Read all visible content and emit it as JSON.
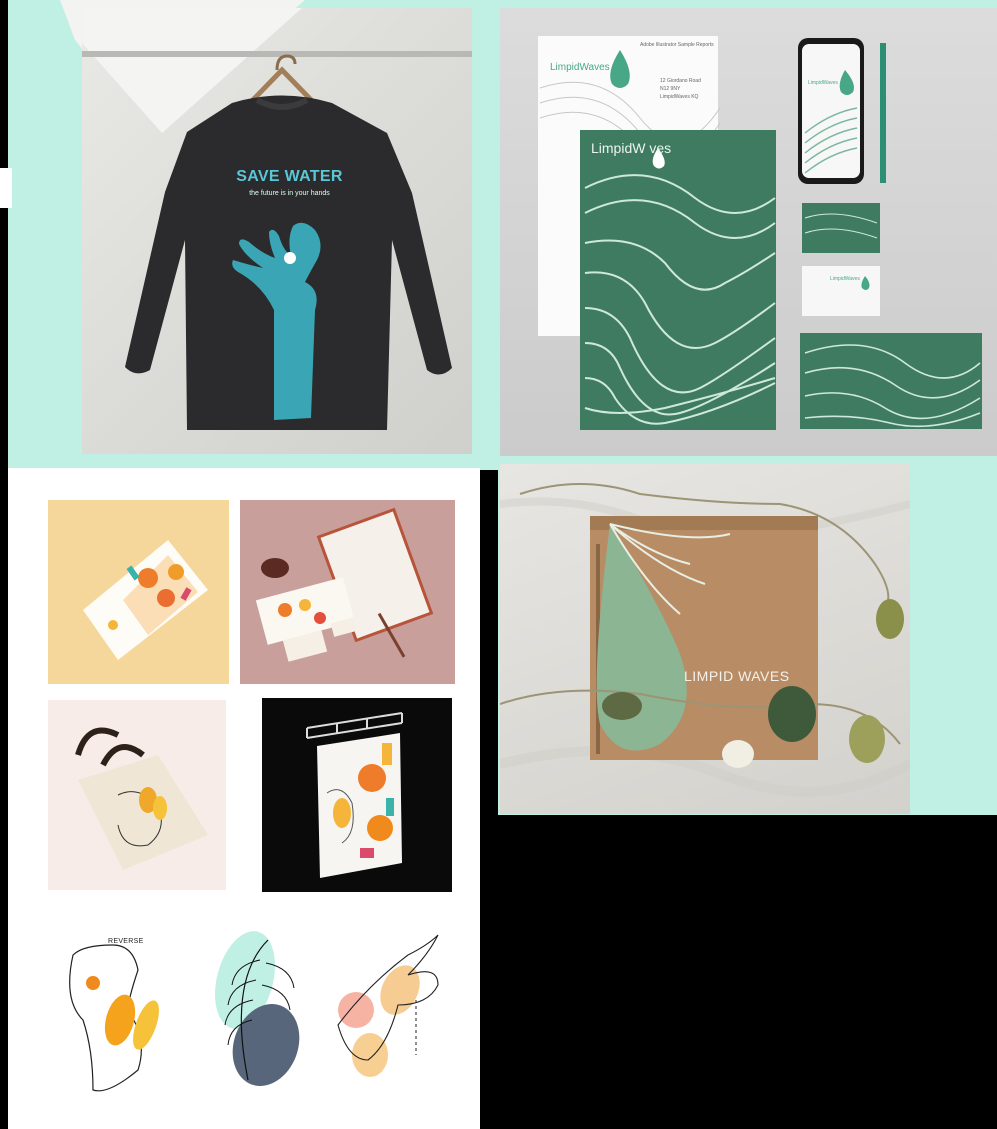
{
  "sweatshirt": {
    "title": "SAVE WATER",
    "subtitle": "the future is in your hands"
  },
  "stationery": {
    "brand_folder": "LimpidW  ves",
    "brand_letterhead": "LimpidWaves",
    "brand_phone": "LimpidWaves",
    "brand_card": "LimpidWaves",
    "letterhead_tag": "Adobe Illustrator Sample Reports",
    "address_lines": [
      "12 Giordano Road",
      "N12 9NY",
      "LimpidWaves KQ"
    ]
  },
  "box": {
    "label": "LIMPID WAVES"
  },
  "illustrations": {
    "label": "REVERSE"
  },
  "colors": {
    "mint": "#bff0e3",
    "green": "#3f7b61",
    "teal": "#3aa6b5",
    "kraft": "#b88d65",
    "orange": "#f08a1c",
    "yellow": "#f6d79b"
  }
}
